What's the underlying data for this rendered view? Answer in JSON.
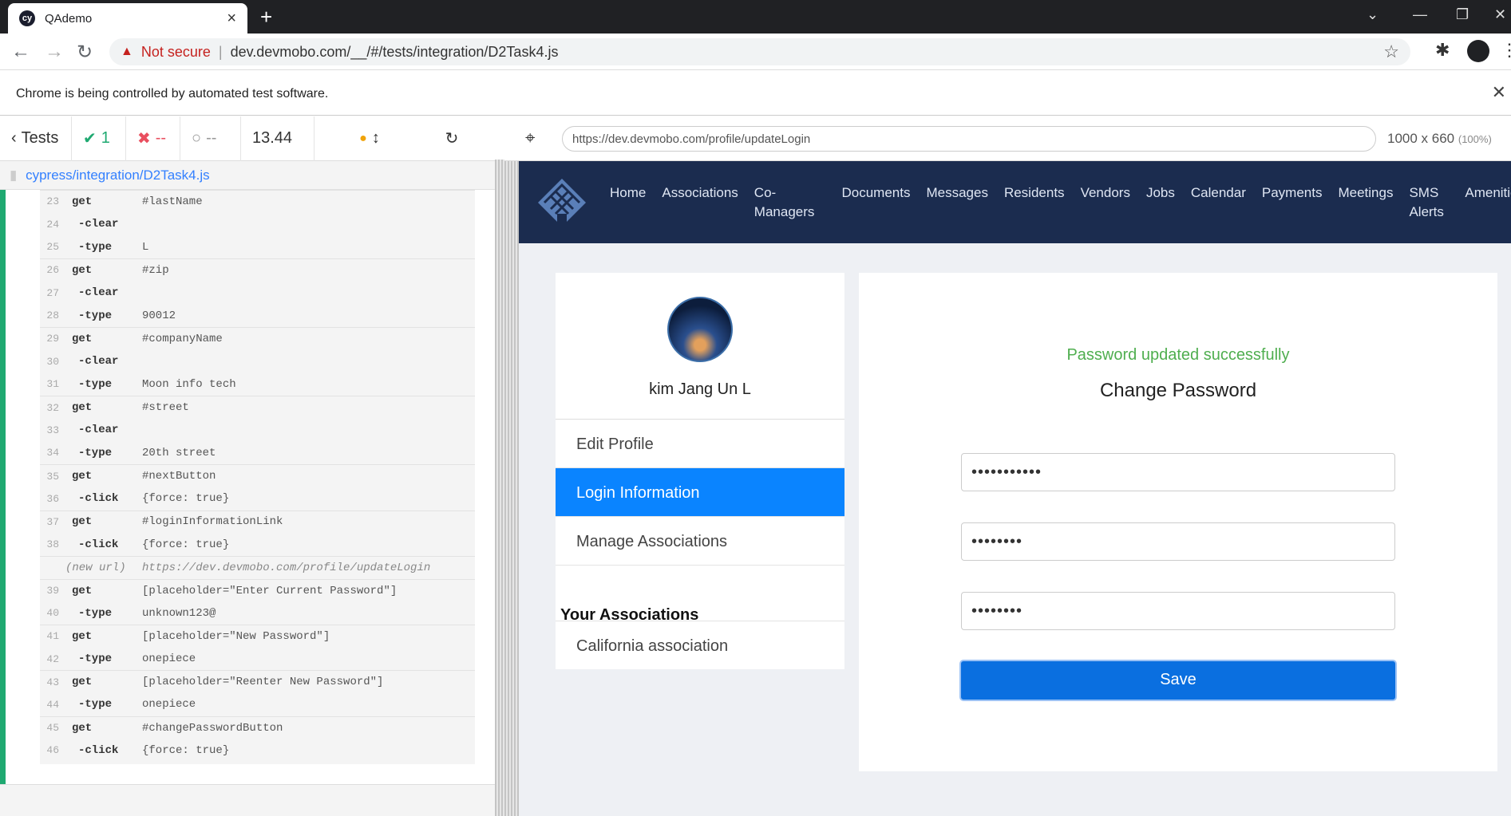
{
  "browser": {
    "tab_title": "QAdemo",
    "favicon_text": "cy",
    "security_label": "Not secure",
    "url": "dev.devmobo.com/__/#/tests/integration/D2Task4.js",
    "infobar_text": "Chrome is being controlled by automated test software."
  },
  "reporter": {
    "back_label": "Tests",
    "passed": "1",
    "failed": "--",
    "pending": "--",
    "duration": "13.44",
    "spec_file": "cypress/integration/D2Task4.js",
    "commands": [
      {
        "num": "23",
        "name": "get",
        "msg": "#lastName"
      },
      {
        "num": "24",
        "name": "-clear",
        "msg": ""
      },
      {
        "num": "25",
        "name": "-type",
        "msg": "L"
      },
      {
        "num": "26",
        "name": "get",
        "msg": "#zip"
      },
      {
        "num": "27",
        "name": "-clear",
        "msg": ""
      },
      {
        "num": "28",
        "name": "-type",
        "msg": "90012"
      },
      {
        "num": "29",
        "name": "get",
        "msg": "#companyName"
      },
      {
        "num": "30",
        "name": "-clear",
        "msg": ""
      },
      {
        "num": "31",
        "name": "-type",
        "msg": "Moon info tech"
      },
      {
        "num": "32",
        "name": "get",
        "msg": "#street"
      },
      {
        "num": "33",
        "name": "-clear",
        "msg": ""
      },
      {
        "num": "34",
        "name": "-type",
        "msg": "20th street"
      },
      {
        "num": "35",
        "name": "get",
        "msg": "#nextButton"
      },
      {
        "num": "36",
        "name": "-click",
        "msg": "{force: true}"
      },
      {
        "num": "37",
        "name": "get",
        "msg": "#loginInformationLink"
      },
      {
        "num": "38",
        "name": "-click",
        "msg": "{force: true}"
      },
      {
        "num": "",
        "name": "(new url)",
        "msg": "https://dev.devmobo.com/profile/updateLogin"
      },
      {
        "num": "39",
        "name": "get",
        "msg": "[placeholder=\"Enter Current Password\"]"
      },
      {
        "num": "40",
        "name": "-type",
        "msg": "unknown123@"
      },
      {
        "num": "41",
        "name": "get",
        "msg": "[placeholder=\"New Password\"]"
      },
      {
        "num": "42",
        "name": "-type",
        "msg": "onepiece"
      },
      {
        "num": "43",
        "name": "get",
        "msg": "[placeholder=\"Reenter New Password\"]"
      },
      {
        "num": "44",
        "name": "-type",
        "msg": "onepiece"
      },
      {
        "num": "45",
        "name": "get",
        "msg": "#changePasswordButton"
      },
      {
        "num": "46",
        "name": "-click",
        "msg": "{force: true}"
      }
    ]
  },
  "aut": {
    "url": "https://dev.devmobo.com/profile/updateLogin",
    "viewport": "1000 x 660",
    "scale": "(100%)"
  },
  "app": {
    "nav": [
      "Home",
      "Associations",
      "Co-Managers",
      "Documents",
      "Messages",
      "Residents",
      "Vendors",
      "Jobs",
      "Calendar",
      "Payments",
      "Meetings",
      "SMS Alerts",
      "Amenities"
    ],
    "user_name": "kim Jang Un L",
    "menu": [
      "Edit Profile",
      "Login Information",
      "Manage Associations"
    ],
    "associations_heading": "Your Associations",
    "associations": [
      "California association"
    ],
    "success_message": "Password updated successfully",
    "form_title": "Change Password",
    "fields": [
      "•••••••••••",
      "••••••••",
      "••••••••"
    ],
    "save_label": "Save"
  }
}
